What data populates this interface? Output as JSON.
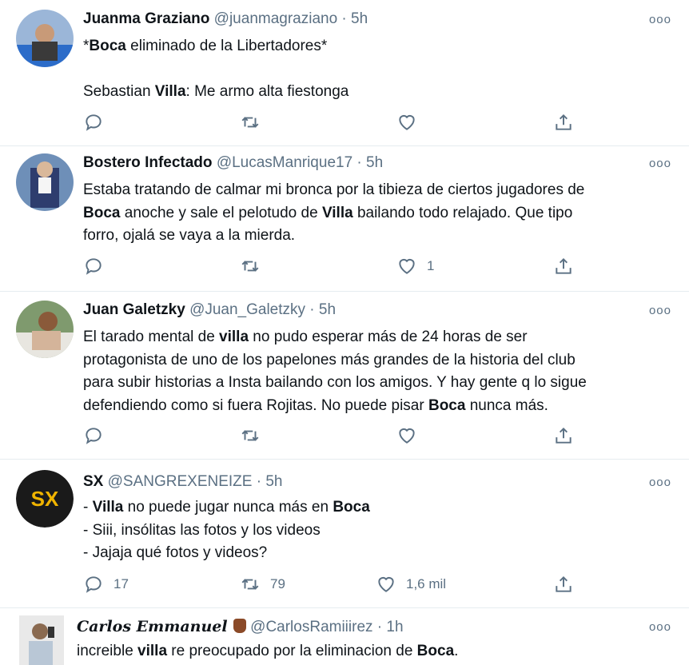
{
  "tweets": [
    {
      "name": "Juanma Graziano",
      "handle": "@juanmagraziano · 5h",
      "lines": [
        [
          {
            "t": "*"
          },
          {
            "t": "Boca",
            "b": true
          },
          {
            "t": " eliminado de la Libertadores*"
          }
        ],
        [],
        [
          {
            "t": "Sebastian "
          },
          {
            "t": "Villa",
            "b": true
          },
          {
            "t": ": Me armo alta fiestonga"
          }
        ]
      ],
      "replies": "",
      "retweets": "",
      "likes": ""
    },
    {
      "name": "Bostero Infectado",
      "handle": "@LucasManrique17 · 5h",
      "lines": [
        [
          {
            "t": "Estaba tratando de calmar mi bronca por la tibieza de ciertos jugadores de"
          }
        ],
        [
          {
            "t": "Boca",
            "b": true
          },
          {
            "t": " anoche y sale el pelotudo de "
          },
          {
            "t": "Villa",
            "b": true
          },
          {
            "t": " bailando todo relajado. Que tipo"
          }
        ],
        [
          {
            "t": "forro, ojalá se vaya a la mierda."
          }
        ]
      ],
      "replies": "",
      "retweets": "",
      "likes": "1"
    },
    {
      "name": "Juan Galetzky",
      "handle": "@Juan_Galetzky · 5h",
      "lines": [
        [
          {
            "t": "El tarado mental de "
          },
          {
            "t": "villa",
            "b": true
          },
          {
            "t": " no pudo esperar más de 24 horas de ser"
          }
        ],
        [
          {
            "t": "protagonista de uno de los papelones más grandes de la historia del club"
          }
        ],
        [
          {
            "t": "para subir historias a Insta bailando con los amigos. Y hay gente q lo sigue"
          }
        ],
        [
          {
            "t": "defendiendo como si fuera Rojitas. No puede pisar "
          },
          {
            "t": "Boca",
            "b": true
          },
          {
            "t": " nunca más."
          }
        ]
      ],
      "replies": "",
      "retweets": "",
      "likes": ""
    },
    {
      "name": "SX",
      "handle": "@SANGREXENEIZE · 5h",
      "logo": "SX",
      "lines": [
        [
          {
            "t": "- "
          },
          {
            "t": "Villa",
            "b": true
          },
          {
            "t": " no puede jugar nunca más en "
          },
          {
            "t": "Boca",
            "b": true
          }
        ],
        [
          {
            "t": "- Siii, insólitas las fotos y los videos"
          }
        ],
        [
          {
            "t": "- Jajaja qué fotos y videos?"
          }
        ]
      ],
      "replies": "17",
      "retweets": "79",
      "likes": "1,6 mil"
    },
    {
      "name": "Carlos Emmanuel",
      "handle": "@CarlosRamiiirez · 1h",
      "lines": [
        [
          {
            "t": "increible "
          },
          {
            "t": "villa",
            "b": true
          },
          {
            "t": " re preocupado por la eliminacion de "
          },
          {
            "t": "Boca",
            "b": true
          },
          {
            "t": "."
          }
        ]
      ],
      "replies": "",
      "retweets": "",
      "likes": ""
    }
  ],
  "icons": {
    "reply": "reply-icon",
    "retweet": "retweet-icon",
    "like": "heart-icon",
    "share": "share-icon",
    "more": "more-icon"
  },
  "more_glyph": "ooo",
  "colors": {
    "text": "#0f1419",
    "muted": "#5b7083",
    "sx_logo": "#f0b400"
  }
}
